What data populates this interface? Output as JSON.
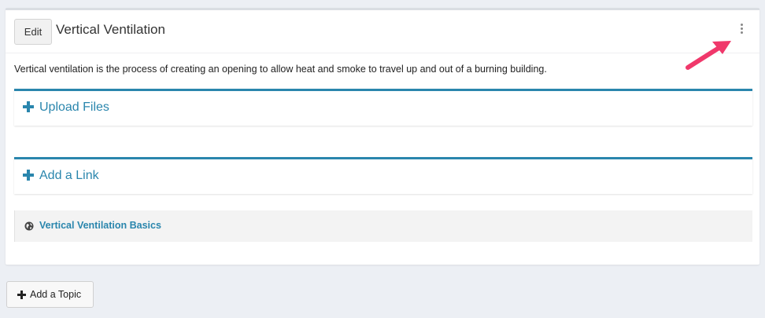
{
  "topic": {
    "edit_label": "Edit",
    "title": "Vertical Ventilation",
    "description": "Vertical ventilation is the process of creating an opening to allow heat and smoke to travel up and out of a burning building.",
    "upload_label": "Upload Files",
    "add_link_label": "Add a Link",
    "links": [
      {
        "icon": "globe-icon",
        "text": "Vertical Ventilation Basics"
      }
    ]
  },
  "add_topic_label": "Add a Topic",
  "colors": {
    "accent": "#2a86ad",
    "annotation_arrow": "#f0386b",
    "background": "#eceff4"
  }
}
